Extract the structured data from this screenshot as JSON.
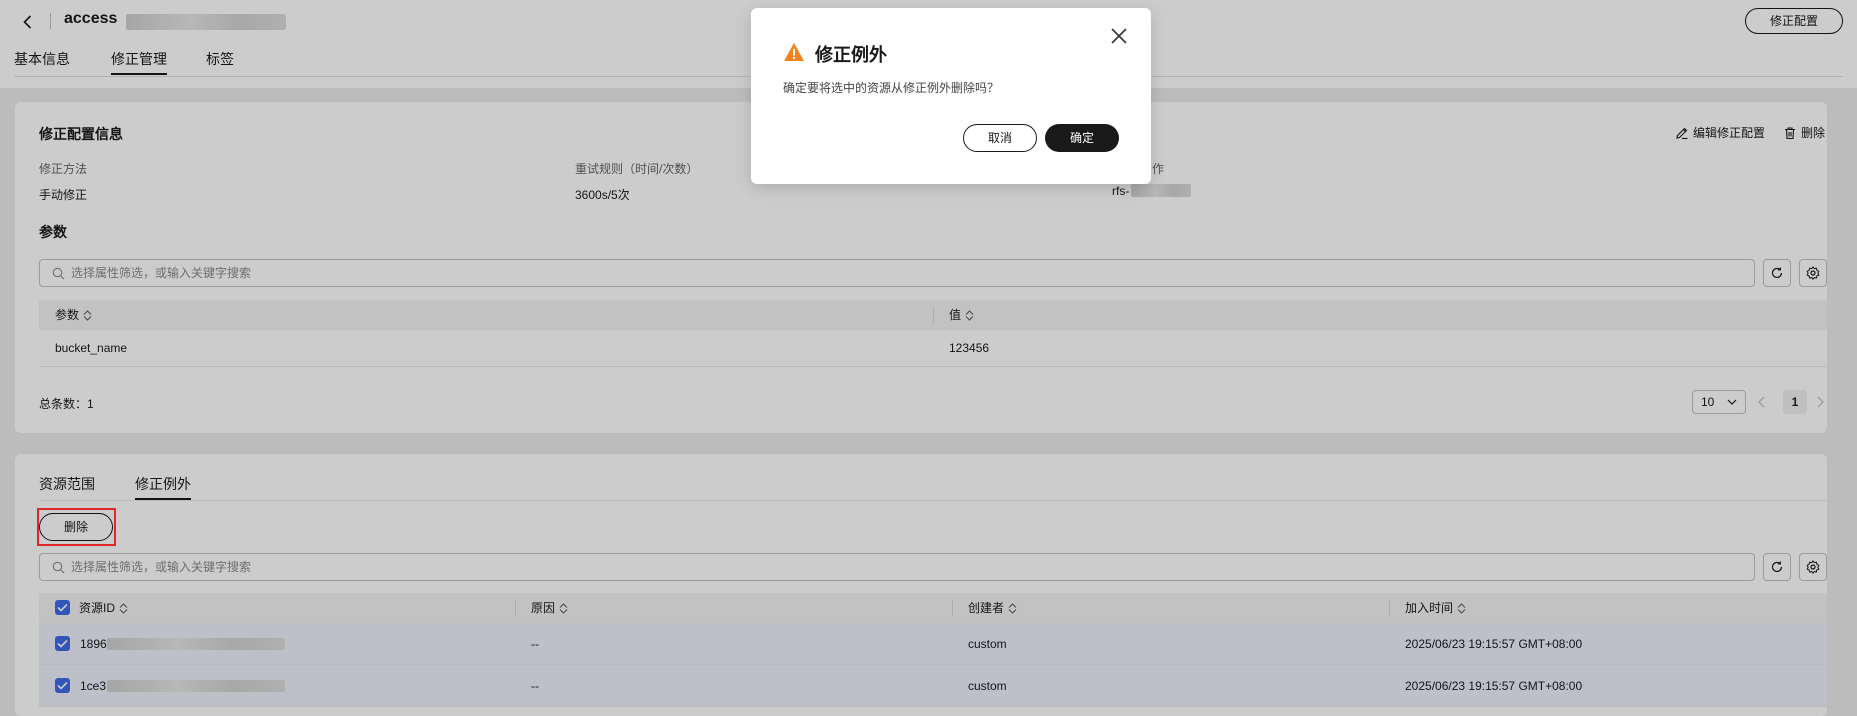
{
  "header": {
    "title": "access",
    "config_button": "修正配置",
    "tabs": [
      "基本信息",
      "修正管理",
      "标签"
    ],
    "active_tab": "修正管理"
  },
  "config_info": {
    "title": "修正配置信息",
    "edit_link": "编辑修正配置",
    "delete_link": "删除",
    "fields": [
      {
        "label": "修正方法",
        "value": "手动修正"
      },
      {
        "label": "重试规则（时间/次数）",
        "value": "3600s/5次"
      },
      {
        "label": "作",
        "value": "rfs-"
      }
    ]
  },
  "params": {
    "title": "参数",
    "search_placeholder": "选择属性筛选，或输入关键字搜索",
    "columns": [
      "参数",
      "值"
    ],
    "rows": [
      {
        "param": "bucket_name",
        "value": "123456"
      }
    ],
    "total": "总条数：1",
    "page_size": "10",
    "current_page": "1"
  },
  "exceptions": {
    "tabs": [
      "资源范围",
      "修正例外"
    ],
    "active_tab": "修正例外",
    "delete_button": "删除",
    "search_placeholder": "选择属性筛选，或输入关键字搜索",
    "columns": [
      "资源ID",
      "原因",
      "创建者",
      "加入时间"
    ],
    "rows": [
      {
        "id": "1896",
        "reason": "--",
        "creator": "custom",
        "time": "2025/06/23 19:15:57 GMT+08:00"
      },
      {
        "id": "1ce3",
        "reason": "--",
        "creator": "custom",
        "time": "2025/06/23 19:15:57 GMT+08:00"
      }
    ]
  },
  "dialog": {
    "title": "修正例外",
    "message": "确定要将选中的资源从修正例外删除吗？",
    "cancel": "取消",
    "ok": "确定"
  },
  "colors": {
    "accent": "#3f6ce6",
    "warning": "#f58220",
    "highlight": "#e02828",
    "primary": "#191919"
  }
}
